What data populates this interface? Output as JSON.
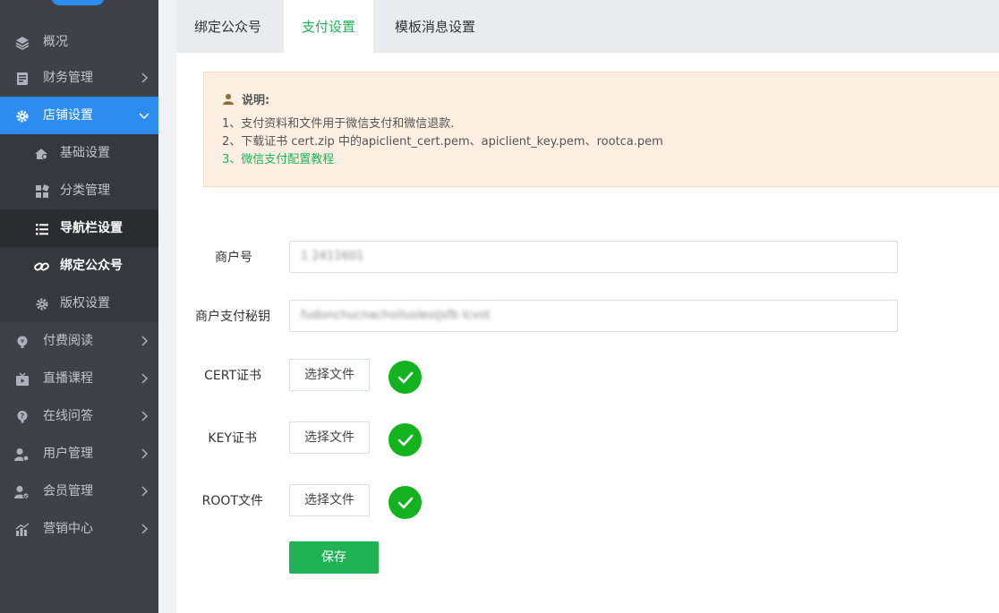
{
  "sidebar": {
    "items": [
      {
        "label": "概况",
        "icon": "layers-icon"
      },
      {
        "label": "财务管理",
        "icon": "finance-icon"
      },
      {
        "label": "店铺设置",
        "icon": "gear-icon"
      },
      {
        "label": "基础设置",
        "icon": "house-icon"
      },
      {
        "label": "分类管理",
        "icon": "grid-icon"
      },
      {
        "label": "导航栏设置",
        "icon": "list-icon"
      },
      {
        "label": "绑定公众号",
        "icon": "link-icon"
      },
      {
        "label": "版权设置",
        "icon": "gear-icon"
      },
      {
        "label": "付费阅读",
        "icon": "coin-icon"
      },
      {
        "label": "直播课程",
        "icon": "video-icon"
      },
      {
        "label": "在线问答",
        "icon": "question-icon"
      },
      {
        "label": "用户管理",
        "icon": "user-gear-icon"
      },
      {
        "label": "会员管理",
        "icon": "member-icon"
      },
      {
        "label": "营销中心",
        "icon": "chart-icon"
      }
    ]
  },
  "tabs": [
    "绑定公众号",
    "支付设置",
    "模板消息设置"
  ],
  "notice": {
    "title": "说明:",
    "lines": [
      "1、支付资料和文件用于微信支付和微信退款.",
      "2、下载证书 cert.zip 中的apiclient_cert.pem、apiclient_key.pem、rootca.pem",
      "3、微信支付配置教程"
    ]
  },
  "form": {
    "merchant_id_label": "商户号",
    "merchant_id_value": "1 2411601",
    "secret_label": "商户支付秘钥",
    "secret_value": "fudonchucnachoilusleoijsfb lcvot",
    "cert_label": "CERT证书",
    "key_label": "KEY证书",
    "root_label": "ROOT文件",
    "file_button": "选择文件",
    "save_button": "保存"
  },
  "colors": {
    "sidebar_bg": "#3f4147",
    "active_blue": "#2d8cf0",
    "brand_green": "#1fb35a",
    "check_green": "#12b31e",
    "notice_bg": "#fdf0e3"
  }
}
